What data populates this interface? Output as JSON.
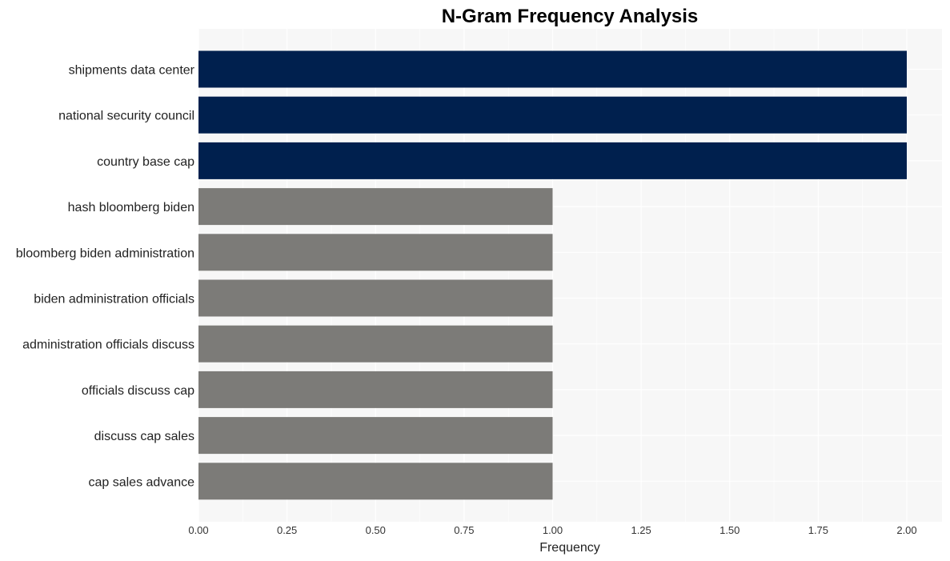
{
  "chart_data": {
    "type": "bar",
    "orientation": "horizontal",
    "title": "N-Gram Frequency Analysis",
    "xlabel": "Frequency",
    "ylabel": "",
    "xlim": [
      0,
      2.1
    ],
    "xticks": [
      "0.00",
      "0.25",
      "0.50",
      "0.75",
      "1.00",
      "1.25",
      "1.50",
      "1.75",
      "2.00"
    ],
    "grid": true,
    "categories": [
      "shipments data center",
      "national security council",
      "country base cap",
      "hash bloomberg biden",
      "bloomberg biden administration",
      "biden administration officials",
      "administration officials discuss",
      "officials discuss cap",
      "discuss cap sales",
      "cap sales advance"
    ],
    "values": [
      2,
      2,
      2,
      1,
      1,
      1,
      1,
      1,
      1,
      1
    ],
    "colors": {
      "highlight": "#00204e",
      "default": "#7c7b78",
      "panel_background": "#f7f7f7",
      "grid": "#ffffff"
    }
  }
}
